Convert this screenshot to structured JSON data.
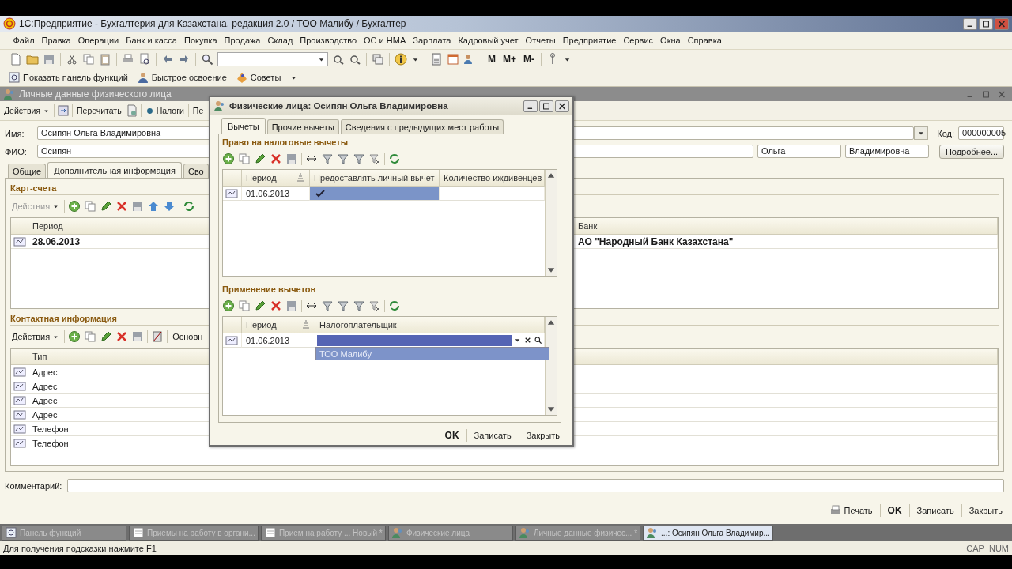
{
  "window": {
    "title": "1С:Предприятие - Бухгалтерия для Казахстана, редакция 2.0 / ТОО Малибу / Бухгалтер"
  },
  "menu": [
    "Файл",
    "Правка",
    "Операции",
    "Банк и касса",
    "Покупка",
    "Продажа",
    "Склад",
    "Производство",
    "ОС и НМА",
    "Зарплата",
    "Кадровый учет",
    "Отчеты",
    "Предприятие",
    "Сервис",
    "Окна",
    "Справка"
  ],
  "toolbar": {
    "memory_buttons": [
      "M",
      "M+",
      "M-"
    ]
  },
  "toolbar2": [
    "Показать панель функций",
    "Быстрое освоение",
    "Советы"
  ],
  "person_window": {
    "title": "Личные данные физического лица",
    "actions": {
      "menu": "Действия",
      "reread": "Перечитать",
      "taxes": "Налоги",
      "cut_button": "Пе"
    },
    "name_label": "Имя:",
    "name": "Осипян Ольга Владимировна",
    "code_label": "Код:",
    "code": "000000005",
    "fio_label": "ФИО:",
    "surname": "Осипян",
    "first_name": "Ольга",
    "patronymic": "Владимировна",
    "details_button": "Подробнее...",
    "tabs": [
      {
        "label": "Общие",
        "selected": false
      },
      {
        "label": "Дополнительная информация",
        "selected": true
      },
      {
        "label": "Сво",
        "selected": false
      }
    ],
    "cards": {
      "title": "Карт-счета",
      "actions": "Действия",
      "actions_disabled": true,
      "columns": [
        "Период",
        "Банк"
      ],
      "rows": [
        {
          "period": "28.06.2013",
          "bank": "АО \"Народный Банк Казахстана\""
        }
      ]
    },
    "contacts": {
      "title": "Контактная информация",
      "actions": "Действия",
      "actions_disabled": false,
      "extra_button": "Основн",
      "columns": [
        "Тип"
      ],
      "rows": [
        "Адрес",
        "Адрес",
        "Адрес",
        "Адрес",
        "Телефон",
        "Телефон"
      ]
    },
    "comment_label": "Комментарий:",
    "buttons": [
      "Печать",
      "OK",
      "Записать",
      "Закрыть"
    ]
  },
  "dialog": {
    "title": "Физические лица: Осипян Ольга Владимировна",
    "tabs": [
      {
        "label": "Вычеты",
        "selected": true
      },
      {
        "label": "Прочие вычеты",
        "selected": false
      },
      {
        "label": "Сведения с предыдущих мест работы",
        "selected": false
      }
    ],
    "deductions": {
      "title": "Право на налоговые вычеты",
      "columns": [
        "Период",
        "Предоставлять личный вычет",
        "Количество иждивенцев"
      ],
      "rows": [
        {
          "period": "01.06.2013",
          "personal_deduction": true,
          "selected": true
        }
      ]
    },
    "application": {
      "title": "Применение вычетов",
      "columns": [
        "Период",
        "Налогоплательщик"
      ],
      "rows": [
        {
          "period": "01.06.2013",
          "editing": true
        }
      ],
      "dropdown": [
        {
          "label": "ТОО Малибу",
          "selected": true
        }
      ]
    },
    "buttons": [
      "OK",
      "Записать",
      "Закрыть"
    ]
  },
  "taskbar": [
    {
      "label": "Панель функций",
      "selected": false
    },
    {
      "label": "Приемы на работу в органи...",
      "selected": false
    },
    {
      "label": "Прием на работу ... Новый *",
      "selected": false
    },
    {
      "label": "Физические лица",
      "selected": false
    },
    {
      "label": "Личные данные физичес... *",
      "selected": false
    },
    {
      "label": "...: Осипян Ольга Владимир...",
      "selected": true
    }
  ],
  "status_bar": {
    "hint": "Для получения подсказки нажмите F1",
    "indicators": [
      "CAP",
      "NUM"
    ]
  }
}
